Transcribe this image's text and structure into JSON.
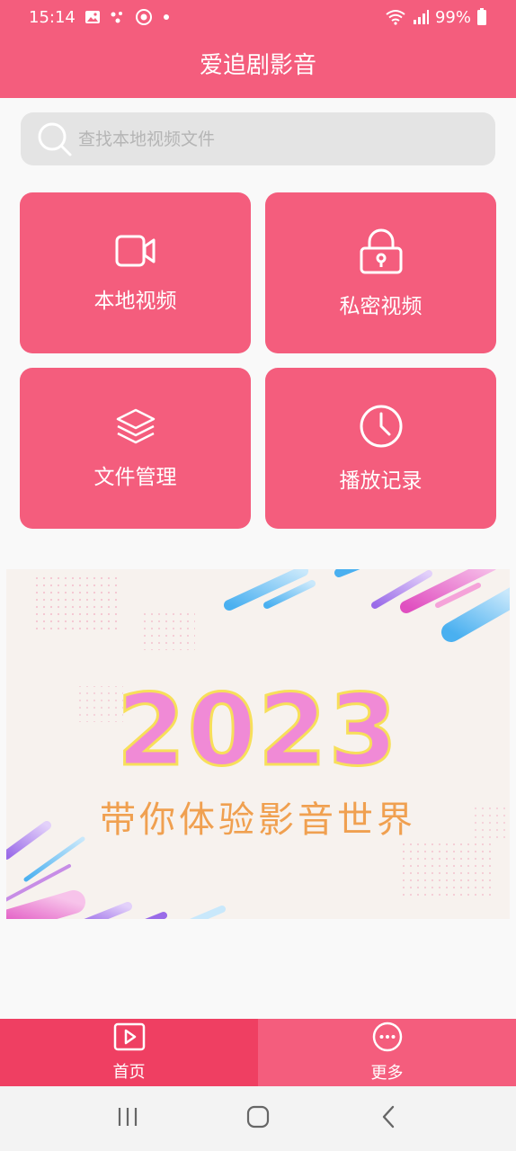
{
  "status_bar": {
    "time": "15:14",
    "battery": "99%"
  },
  "header": {
    "title": "爱追剧影音"
  },
  "search": {
    "placeholder": "查找本地视频文件"
  },
  "tiles": [
    {
      "label": "本地视频",
      "icon": "video-camera-icon"
    },
    {
      "label": "私密视频",
      "icon": "lock-icon"
    },
    {
      "label": "文件管理",
      "icon": "layers-icon"
    },
    {
      "label": "播放记录",
      "icon": "clock-icon"
    }
  ],
  "banner": {
    "year": "2023",
    "slogan": "带你体验影音世界"
  },
  "bottom_nav": {
    "items": [
      {
        "label": "首页",
        "icon": "play-square-icon",
        "active": true
      },
      {
        "label": "更多",
        "icon": "more-circle-icon",
        "active": false
      }
    ]
  },
  "colors": {
    "primary": "#f45d7d",
    "primary_dark": "#ef3f62",
    "search_bg": "#e4e4e4",
    "banner_year": "#f08ad6",
    "banner_slogan": "#f0a050"
  }
}
